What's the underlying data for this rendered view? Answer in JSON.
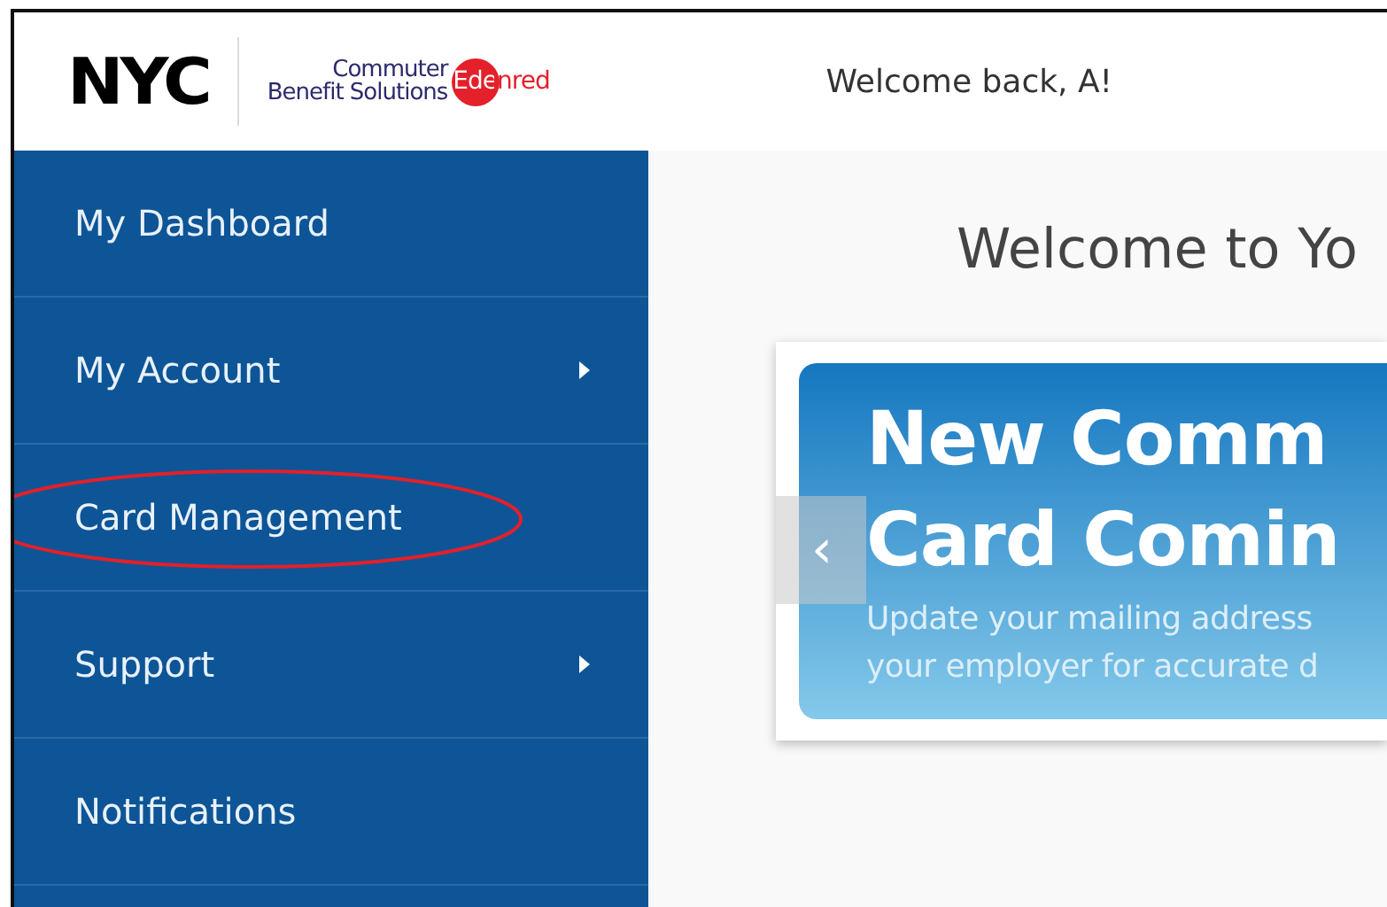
{
  "header": {
    "logo": "NYC",
    "brand_line_1": "Commuter",
    "brand_line_2": "Benefit Solutions",
    "brand_badge": "Edenred",
    "greeting": "Welcome back, A!"
  },
  "sidebar": {
    "items": [
      {
        "label": "My Dashboard",
        "has_submenu": false,
        "circled": false
      },
      {
        "label": "My Account",
        "has_submenu": true,
        "circled": false
      },
      {
        "label": "Card Management",
        "has_submenu": false,
        "circled": true
      },
      {
        "label": "Support",
        "has_submenu": true,
        "circled": false
      },
      {
        "label": "Notifications",
        "has_submenu": false,
        "circled": false
      }
    ]
  },
  "main": {
    "title": "Welcome to Yo",
    "banner": {
      "prev": "‹",
      "headline": [
        "New Comm",
        "Card Comin"
      ],
      "text": [
        "Update your mailing address",
        "your employer for accurate d"
      ]
    }
  }
}
